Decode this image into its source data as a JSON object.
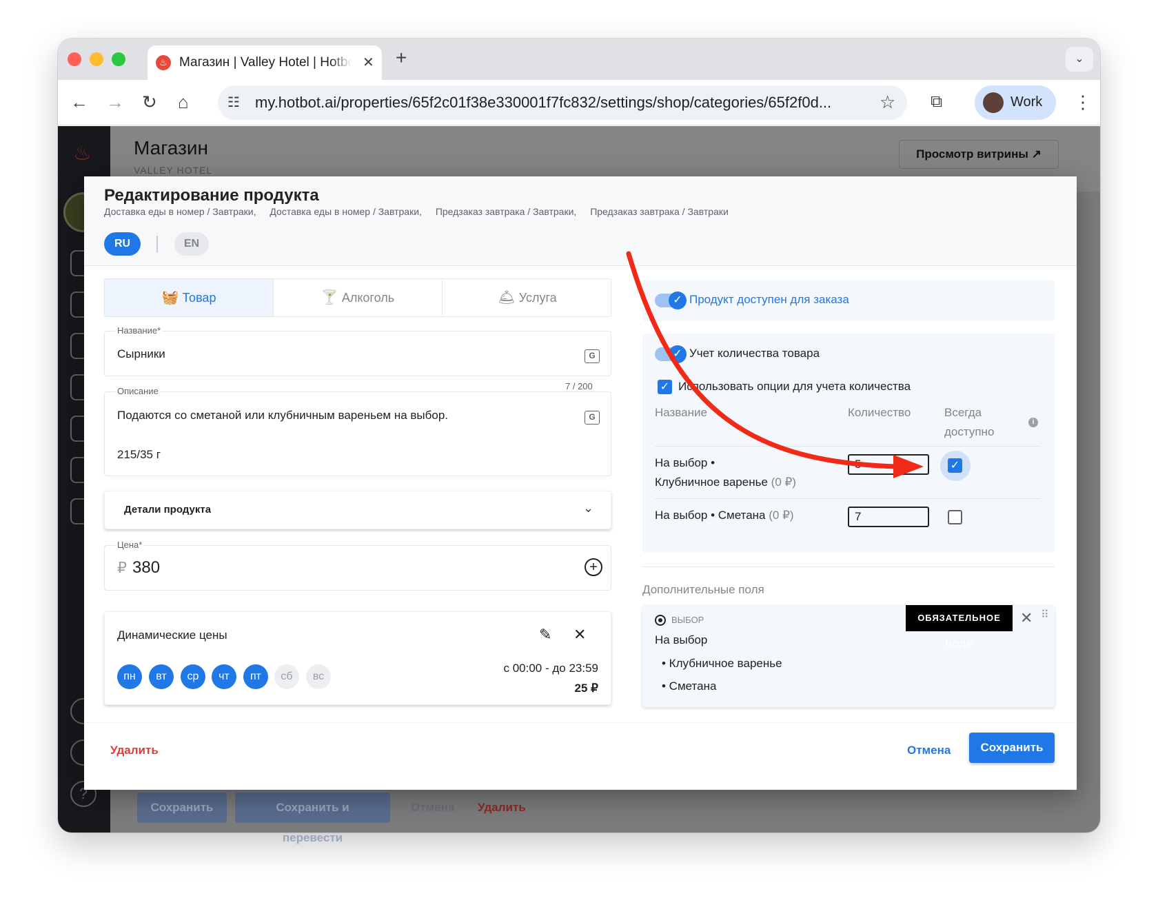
{
  "browser": {
    "tab_title": "Магазин | Valley Hotel | Hotbot",
    "url": "my.hotbot.ai/properties/65f2c01f38e330001f7fc832/settings/shop/categories/65f2f0d...",
    "profile_name": "Work"
  },
  "page": {
    "title": "Магазин",
    "subtitle": "VALLEY HOTEL",
    "storefront_button": "Просмотр витрины ↗",
    "bottom_buttons": {
      "save": "Сохранить",
      "save_translate": "Сохранить и перевести",
      "cancel": "Отмена",
      "delete": "Удалить"
    }
  },
  "modal": {
    "title": "Редактирование продукта",
    "categories": [
      "Доставка еды в номер / Завтраки,",
      "Доставка еды в номер / Завтраки,",
      "Предзаказ завтрака / Завтраки,",
      "Предзаказ завтрака / Завтраки"
    ],
    "languages": [
      "RU",
      "EN"
    ],
    "type_tabs": [
      "Товар",
      "Алкоголь",
      "Услуга"
    ],
    "name_field": {
      "label": "Название*",
      "value": "Сырники"
    },
    "description_field": {
      "label": "Описание",
      "counter": "7 / 200",
      "line1": "Подаются со сметаной или клубничным вареньем на выбор.",
      "line2": "215/35 г"
    },
    "details_label": "Детали продукта",
    "price_field": {
      "label": "Цена*",
      "currency": "₽",
      "value": "380"
    },
    "dynamic_prices": {
      "title": "Динамические цены",
      "days": [
        {
          "label": "пн",
          "active": true
        },
        {
          "label": "вт",
          "active": true
        },
        {
          "label": "ср",
          "active": true
        },
        {
          "label": "чт",
          "active": true
        },
        {
          "label": "пт",
          "active": true
        },
        {
          "label": "сб",
          "active": false
        },
        {
          "label": "вс",
          "active": false
        }
      ],
      "time": "с 00:00 - до 23:59",
      "amount": "25 ₽"
    },
    "available_label": "Продукт доступен для заказа",
    "inventory": {
      "toggle_label": "Учет количества товара",
      "use_options_label": "Использовать опции для учета количества",
      "col_name": "Название",
      "col_qty": "Количество",
      "col_always_line1": "Всегда",
      "col_always_line2": "доступно",
      "rows": [
        {
          "name_line1": "На выбор •",
          "name_line2": "Клубничное варенье",
          "price": "(0 ₽)",
          "qty": "5",
          "always": true
        },
        {
          "name_line1": "На выбор • Сметана",
          "price": "(0 ₽)",
          "qty": "7",
          "always": false
        }
      ]
    },
    "extra_fields": {
      "title": "Дополнительные поля",
      "type_label": "ВЫБОР",
      "required_chip": "ОБЯЗАТЕЛЬНОЕ ПОЛЕ",
      "name": "На выбор",
      "options": [
        "• Клубничное варенье",
        "• Сметана"
      ]
    },
    "footer": {
      "delete": "Удалить",
      "cancel": "Отмена",
      "save": "Сохранить"
    }
  },
  "colors": {
    "accent": "#1f78e6",
    "danger": "#e53935",
    "annotation_arrow": "#f02a17"
  }
}
